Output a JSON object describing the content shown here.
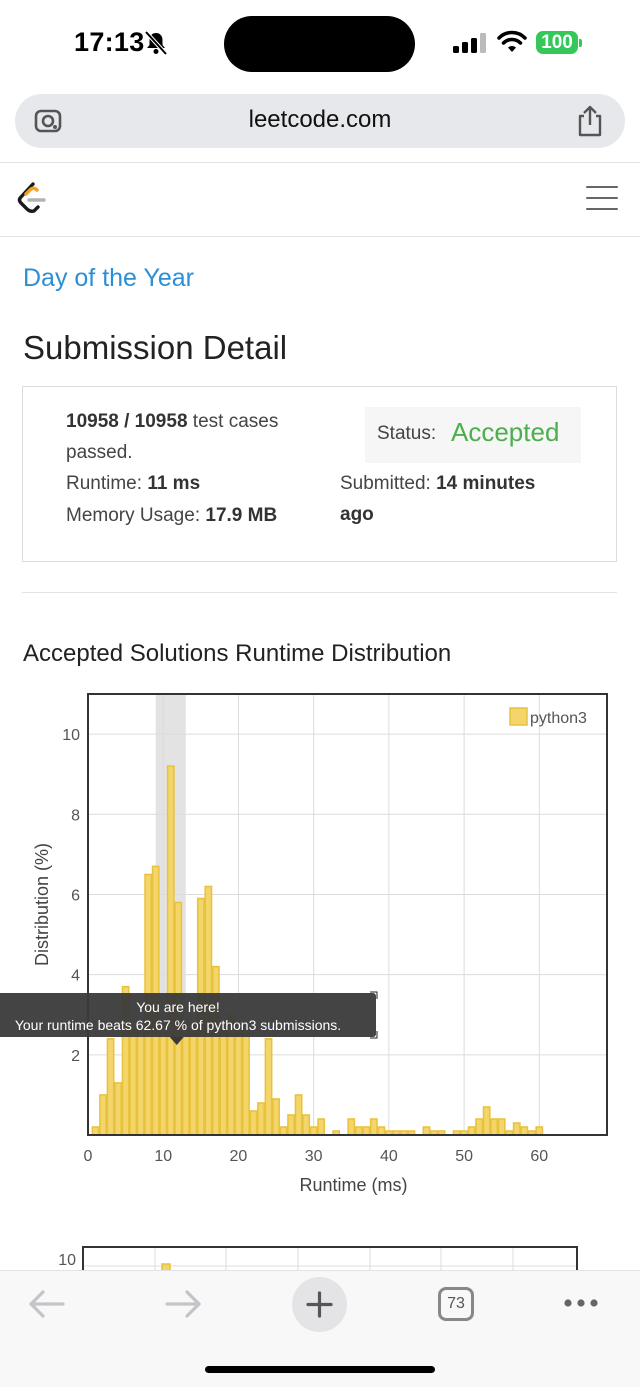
{
  "status_bar": {
    "time": "17:13",
    "battery": "100"
  },
  "browser": {
    "url": "leetcode.com",
    "tab_count": "73"
  },
  "page": {
    "problem_link": "Day of the Year",
    "title": "Submission Detail",
    "section_title": "Accepted Solutions Runtime Distribution"
  },
  "detail": {
    "passed": "10958 / 10958",
    "passed_suffix": "test cases",
    "passed_suffix2": "passed.",
    "status_label": "Status:",
    "status_value": "Accepted",
    "runtime_label": "Runtime:",
    "runtime_value": "11 ms",
    "memory_label": "Memory Usage:",
    "memory_value": "17.9 MB",
    "submitted_label": "Submitted:",
    "submitted_value_1": "14 minutes",
    "submitted_value_2": "ago"
  },
  "tooltip": {
    "line1": "You are here!",
    "line2": "Your runtime beats 62.67 % of python3 submissions."
  },
  "colors": {
    "bar_fill": "#f3d56a",
    "bar_stroke": "#e8c23c",
    "accepted": "#4cae4c",
    "link": "#2c8fd6"
  },
  "chart_data": {
    "type": "bar",
    "xlabel": "Runtime (ms)",
    "ylabel": "Distribution (%)",
    "legend": [
      "python3"
    ],
    "legend_position": "top-right",
    "xlim": [
      0,
      69
    ],
    "ylim": [
      0,
      11
    ],
    "xticks": [
      0,
      10,
      20,
      30,
      40,
      50,
      60
    ],
    "yticks": [
      2,
      4,
      6,
      8,
      10
    ],
    "highlight_range": [
      9,
      13
    ],
    "series": [
      {
        "name": "python3",
        "x": [
          1,
          2,
          3,
          4,
          5,
          6,
          7,
          8,
          9,
          10,
          11,
          12,
          13,
          14,
          15,
          16,
          17,
          18,
          19,
          20,
          21,
          22,
          23,
          24,
          25,
          26,
          27,
          28,
          29,
          30,
          31,
          33,
          35,
          36,
          37,
          38,
          39,
          40,
          41,
          42,
          43,
          45,
          46,
          47,
          49,
          50,
          51,
          52,
          53,
          54,
          55,
          56,
          57,
          58,
          59,
          60
        ],
        "y": [
          0.2,
          1.0,
          2.4,
          1.3,
          3.7,
          2.6,
          2.6,
          6.5,
          6.7,
          2.6,
          9.2,
          5.8,
          2.8,
          2.6,
          5.9,
          6.2,
          4.2,
          2.6,
          3.0,
          2.6,
          2.6,
          0.6,
          0.8,
          2.4,
          0.9,
          0.2,
          0.5,
          1.0,
          0.5,
          0.2,
          0.4,
          0.1,
          0.4,
          0.2,
          0.2,
          0.4,
          0.2,
          0.1,
          0.1,
          0.1,
          0.1,
          0.2,
          0.1,
          0.1,
          0.1,
          0.1,
          0.2,
          0.4,
          0.7,
          0.4,
          0.4,
          0.1,
          0.3,
          0.2,
          0.1,
          0.2
        ]
      }
    ]
  },
  "chart2_data": {
    "yticks": [
      10
    ]
  }
}
